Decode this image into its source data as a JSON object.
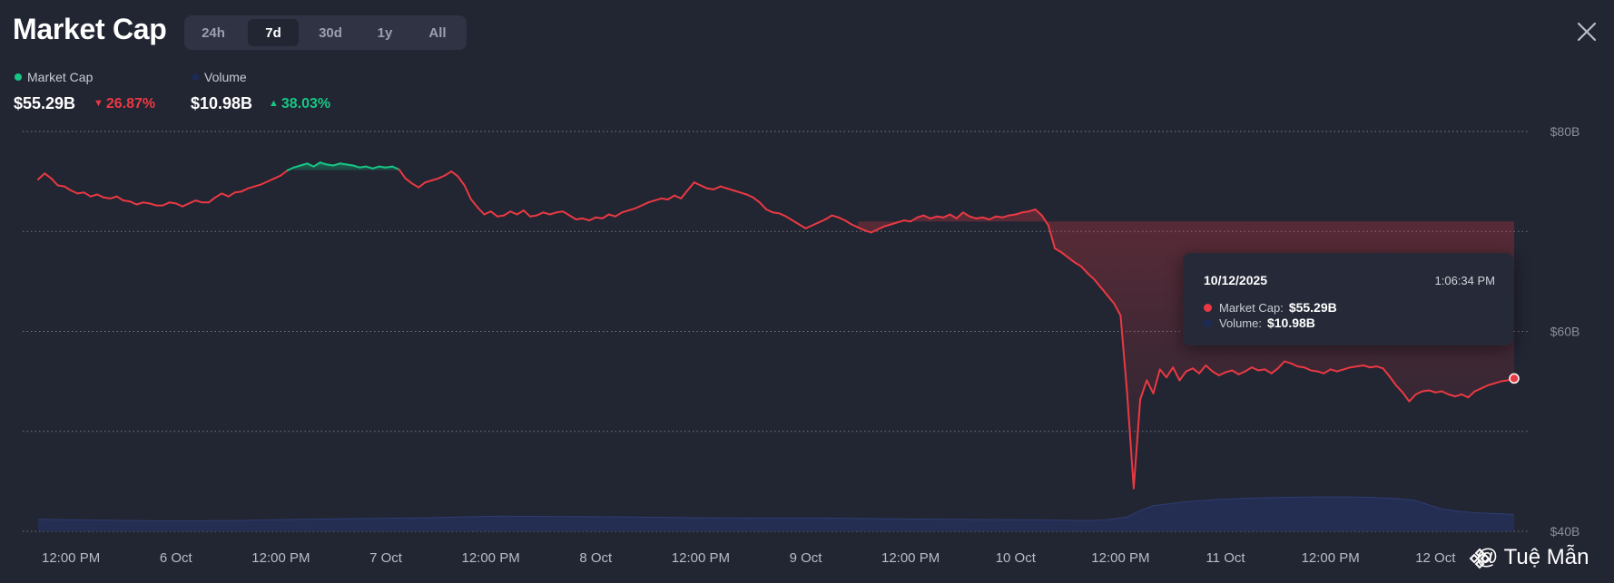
{
  "header": {
    "title": "Market Cap",
    "ranges": [
      "24h",
      "7d",
      "30d",
      "1y",
      "All"
    ],
    "active_range": "7d"
  },
  "legend": {
    "market_cap": {
      "label": "Market Cap",
      "value": "$55.29B",
      "change": "26.87%",
      "direction": "down",
      "color": "#16c784"
    },
    "volume": {
      "label": "Volume",
      "value": "$10.98B",
      "change": "38.03%",
      "direction": "up",
      "color": "#1e2a56"
    }
  },
  "tooltip": {
    "date": "10/12/2025",
    "time": "1:06:34 PM",
    "market_cap_label": "Market Cap:",
    "market_cap_value": "$55.29B",
    "volume_label": "Volume:",
    "volume_value": "$10.98B"
  },
  "watermark": "@ Tuệ Mẫn",
  "colors": {
    "background": "#222532",
    "up": "#16c784",
    "down": "#ea3943",
    "volume": "#2b3a6e"
  },
  "chart_data": {
    "type": "line",
    "series": [
      {
        "name": "Market Cap",
        "unit": "$B",
        "baseline": 76.1,
        "points": [
          [
            0,
            75.2
          ],
          [
            1,
            75.8
          ],
          [
            2,
            75.3
          ],
          [
            3,
            74.6
          ],
          [
            4,
            74.5
          ],
          [
            5,
            74.1
          ],
          [
            6,
            73.8
          ],
          [
            7,
            73.9
          ],
          [
            8,
            73.5
          ],
          [
            9,
            73.7
          ],
          [
            10,
            73.4
          ],
          [
            11,
            73.3
          ],
          [
            12,
            73.5
          ],
          [
            13,
            73.1
          ],
          [
            14,
            73.0
          ],
          [
            15,
            72.7
          ],
          [
            16,
            72.9
          ],
          [
            17,
            72.8
          ],
          [
            18,
            72.6
          ],
          [
            19,
            72.6
          ],
          [
            20,
            72.9
          ],
          [
            21,
            72.8
          ],
          [
            22,
            72.5
          ],
          [
            23,
            72.8
          ],
          [
            24,
            73.1
          ],
          [
            25,
            72.9
          ],
          [
            26,
            72.9
          ],
          [
            27,
            73.4
          ],
          [
            28,
            73.8
          ],
          [
            29,
            73.5
          ],
          [
            30,
            73.9
          ],
          [
            31,
            74.0
          ],
          [
            32,
            74.3
          ],
          [
            33,
            74.5
          ],
          [
            34,
            74.7
          ],
          [
            35,
            75.0
          ],
          [
            36,
            75.3
          ],
          [
            37,
            75.6
          ],
          [
            38,
            76.1
          ],
          [
            39,
            76.4
          ],
          [
            40,
            76.6
          ],
          [
            41,
            76.8
          ],
          [
            42,
            76.5
          ],
          [
            43,
            76.9
          ],
          [
            44,
            76.7
          ],
          [
            45,
            76.6
          ],
          [
            46,
            76.8
          ],
          [
            47,
            76.7
          ],
          [
            48,
            76.6
          ],
          [
            49,
            76.4
          ],
          [
            50,
            76.5
          ],
          [
            51,
            76.3
          ],
          [
            52,
            76.5
          ],
          [
            53,
            76.4
          ],
          [
            54,
            76.5
          ],
          [
            55,
            76.2
          ],
          [
            56,
            75.3
          ],
          [
            57,
            74.8
          ],
          [
            58,
            74.4
          ],
          [
            59,
            74.9
          ],
          [
            60,
            75.1
          ],
          [
            61,
            75.3
          ],
          [
            62,
            75.6
          ],
          [
            63,
            76.0
          ],
          [
            64,
            75.5
          ],
          [
            65,
            74.6
          ],
          [
            66,
            73.2
          ],
          [
            67,
            72.4
          ],
          [
            68,
            71.7
          ],
          [
            69,
            72.0
          ],
          [
            70,
            71.5
          ],
          [
            71,
            71.6
          ],
          [
            72,
            72.0
          ],
          [
            73,
            71.7
          ],
          [
            74,
            72.1
          ],
          [
            75,
            71.5
          ],
          [
            76,
            71.6
          ],
          [
            77,
            71.9
          ],
          [
            78,
            71.7
          ],
          [
            79,
            71.9
          ],
          [
            80,
            72.0
          ],
          [
            81,
            71.6
          ],
          [
            82,
            71.2
          ],
          [
            83,
            71.3
          ],
          [
            84,
            71.1
          ],
          [
            85,
            71.4
          ],
          [
            86,
            71.3
          ],
          [
            87,
            71.7
          ],
          [
            88,
            71.5
          ],
          [
            89,
            71.9
          ],
          [
            90,
            72.1
          ],
          [
            91,
            72.3
          ],
          [
            92,
            72.6
          ],
          [
            93,
            72.9
          ],
          [
            94,
            73.1
          ],
          [
            95,
            73.3
          ],
          [
            96,
            73.2
          ],
          [
            97,
            73.6
          ],
          [
            98,
            73.3
          ],
          [
            99,
            74.1
          ],
          [
            100,
            74.9
          ],
          [
            101,
            74.6
          ],
          [
            102,
            74.3
          ],
          [
            103,
            74.2
          ],
          [
            104,
            74.5
          ],
          [
            105,
            74.3
          ],
          [
            106,
            74.1
          ],
          [
            107,
            73.9
          ],
          [
            108,
            73.7
          ],
          [
            109,
            73.4
          ],
          [
            110,
            72.9
          ],
          [
            111,
            72.2
          ],
          [
            112,
            71.9
          ],
          [
            113,
            71.8
          ],
          [
            114,
            71.5
          ],
          [
            115,
            71.1
          ],
          [
            116,
            70.7
          ],
          [
            117,
            70.3
          ],
          [
            118,
            70.6
          ],
          [
            119,
            70.9
          ],
          [
            120,
            71.2
          ],
          [
            121,
            71.6
          ],
          [
            122,
            71.4
          ],
          [
            123,
            71.1
          ],
          [
            124,
            70.7
          ],
          [
            125,
            70.4
          ],
          [
            126,
            70.1
          ],
          [
            127,
            69.9
          ],
          [
            128,
            70.2
          ],
          [
            129,
            70.5
          ],
          [
            130,
            70.7
          ],
          [
            131,
            70.9
          ],
          [
            132,
            71.1
          ],
          [
            133,
            71.0
          ],
          [
            134,
            71.4
          ],
          [
            135,
            71.6
          ],
          [
            136,
            71.3
          ],
          [
            137,
            71.5
          ],
          [
            138,
            71.4
          ],
          [
            139,
            71.7
          ],
          [
            140,
            71.3
          ],
          [
            141,
            71.9
          ],
          [
            142,
            71.5
          ],
          [
            143,
            71.3
          ],
          [
            144,
            71.4
          ],
          [
            145,
            71.2
          ],
          [
            146,
            71.5
          ],
          [
            147,
            71.4
          ],
          [
            148,
            71.6
          ],
          [
            149,
            71.7
          ],
          [
            150,
            71.9
          ],
          [
            151,
            72.0
          ],
          [
            152,
            72.2
          ],
          [
            153,
            71.6
          ],
          [
            154,
            70.6
          ],
          [
            155,
            68.3
          ],
          [
            156,
            67.9
          ],
          [
            157,
            67.4
          ],
          [
            158,
            66.9
          ],
          [
            159,
            66.5
          ],
          [
            160,
            65.8
          ],
          [
            161,
            65.2
          ],
          [
            162,
            64.4
          ],
          [
            163,
            63.6
          ],
          [
            164,
            62.8
          ],
          [
            165,
            61.6
          ],
          [
            166,
            53.9
          ],
          [
            167,
            44.3
          ],
          [
            168,
            53.2
          ],
          [
            169,
            55.1
          ],
          [
            170,
            53.8
          ],
          [
            171,
            56.2
          ],
          [
            172,
            55.4
          ],
          [
            173,
            56.4
          ],
          [
            174,
            55.1
          ],
          [
            175,
            56.0
          ],
          [
            176,
            56.3
          ],
          [
            177,
            55.8
          ],
          [
            178,
            56.6
          ],
          [
            179,
            56.0
          ],
          [
            180,
            55.6
          ],
          [
            181,
            55.9
          ],
          [
            182,
            56.1
          ],
          [
            183,
            55.7
          ],
          [
            184,
            56.0
          ],
          [
            185,
            56.4
          ],
          [
            186,
            56.1
          ],
          [
            187,
            56.2
          ],
          [
            188,
            55.8
          ],
          [
            189,
            56.3
          ],
          [
            190,
            57.0
          ],
          [
            191,
            56.8
          ],
          [
            192,
            56.5
          ],
          [
            193,
            56.4
          ],
          [
            194,
            56.1
          ],
          [
            195,
            56.0
          ],
          [
            196,
            55.8
          ],
          [
            197,
            56.2
          ],
          [
            198,
            56.0
          ],
          [
            199,
            56.2
          ],
          [
            200,
            56.4
          ],
          [
            201,
            56.5
          ],
          [
            202,
            56.6
          ],
          [
            203,
            56.4
          ],
          [
            204,
            56.5
          ],
          [
            205,
            56.3
          ],
          [
            206,
            55.5
          ],
          [
            207,
            54.6
          ],
          [
            208,
            53.9
          ],
          [
            209,
            53.0
          ],
          [
            210,
            53.7
          ],
          [
            211,
            54.0
          ],
          [
            212,
            54.1
          ],
          [
            213,
            53.9
          ],
          [
            214,
            54.0
          ],
          [
            215,
            53.7
          ],
          [
            216,
            53.5
          ],
          [
            217,
            53.7
          ],
          [
            218,
            53.4
          ],
          [
            219,
            54.0
          ],
          [
            220,
            54.3
          ],
          [
            221,
            54.6
          ],
          [
            222,
            54.8
          ],
          [
            223,
            55.0
          ],
          [
            224,
            55.1
          ],
          [
            225,
            55.29
          ]
        ]
      },
      {
        "name": "Volume",
        "unit": "$B",
        "display_min": 0,
        "display_max": 100,
        "points": [
          [
            0,
            3.0
          ],
          [
            10,
            2.8
          ],
          [
            20,
            2.6
          ],
          [
            30,
            2.7
          ],
          [
            40,
            3.0
          ],
          [
            50,
            3.2
          ],
          [
            60,
            3.4
          ],
          [
            65,
            3.6
          ],
          [
            70,
            3.8
          ],
          [
            80,
            3.7
          ],
          [
            90,
            3.6
          ],
          [
            100,
            3.4
          ],
          [
            110,
            3.3
          ],
          [
            120,
            3.3
          ],
          [
            130,
            3.1
          ],
          [
            140,
            3.0
          ],
          [
            150,
            2.9
          ],
          [
            160,
            2.7
          ],
          [
            163,
            2.9
          ],
          [
            166,
            3.6
          ],
          [
            168,
            5.2
          ],
          [
            170,
            6.4
          ],
          [
            175,
            7.4
          ],
          [
            180,
            8.0
          ],
          [
            185,
            8.3
          ],
          [
            190,
            8.5
          ],
          [
            195,
            8.6
          ],
          [
            200,
            8.6
          ],
          [
            203,
            8.5
          ],
          [
            207,
            8.2
          ],
          [
            210,
            7.7
          ],
          [
            212,
            6.6
          ],
          [
            214,
            5.6
          ],
          [
            217,
            4.9
          ],
          [
            220,
            4.6
          ],
          [
            224,
            4.3
          ],
          [
            225,
            4.2
          ]
        ]
      }
    ],
    "x_ticks": [
      {
        "x": 5,
        "label": "12:00 PM"
      },
      {
        "x": 21,
        "label": "6 Oct"
      },
      {
        "x": 37,
        "label": "12:00 PM"
      },
      {
        "x": 53,
        "label": "7 Oct"
      },
      {
        "x": 69,
        "label": "12:00 PM"
      },
      {
        "x": 85,
        "label": "8 Oct"
      },
      {
        "x": 101,
        "label": "12:00 PM"
      },
      {
        "x": 117,
        "label": "9 Oct"
      },
      {
        "x": 133,
        "label": "12:00 PM"
      },
      {
        "x": 149,
        "label": "10 Oct"
      },
      {
        "x": 165,
        "label": "12:00 PM"
      },
      {
        "x": 181,
        "label": "11 Oct"
      },
      {
        "x": 197,
        "label": "12:00 PM"
      },
      {
        "x": 213,
        "label": "12 Oct"
      }
    ],
    "y_ticks": [
      {
        "value": 80,
        "label": "$80B"
      },
      {
        "value": 60,
        "label": "$60B"
      },
      {
        "value": 40,
        "label": "$40B"
      }
    ],
    "gridlines": [
      80,
      70,
      60,
      50,
      40
    ],
    "ylim": [
      40,
      80
    ],
    "xlim": [
      0,
      225
    ],
    "hover_index": 225
  }
}
